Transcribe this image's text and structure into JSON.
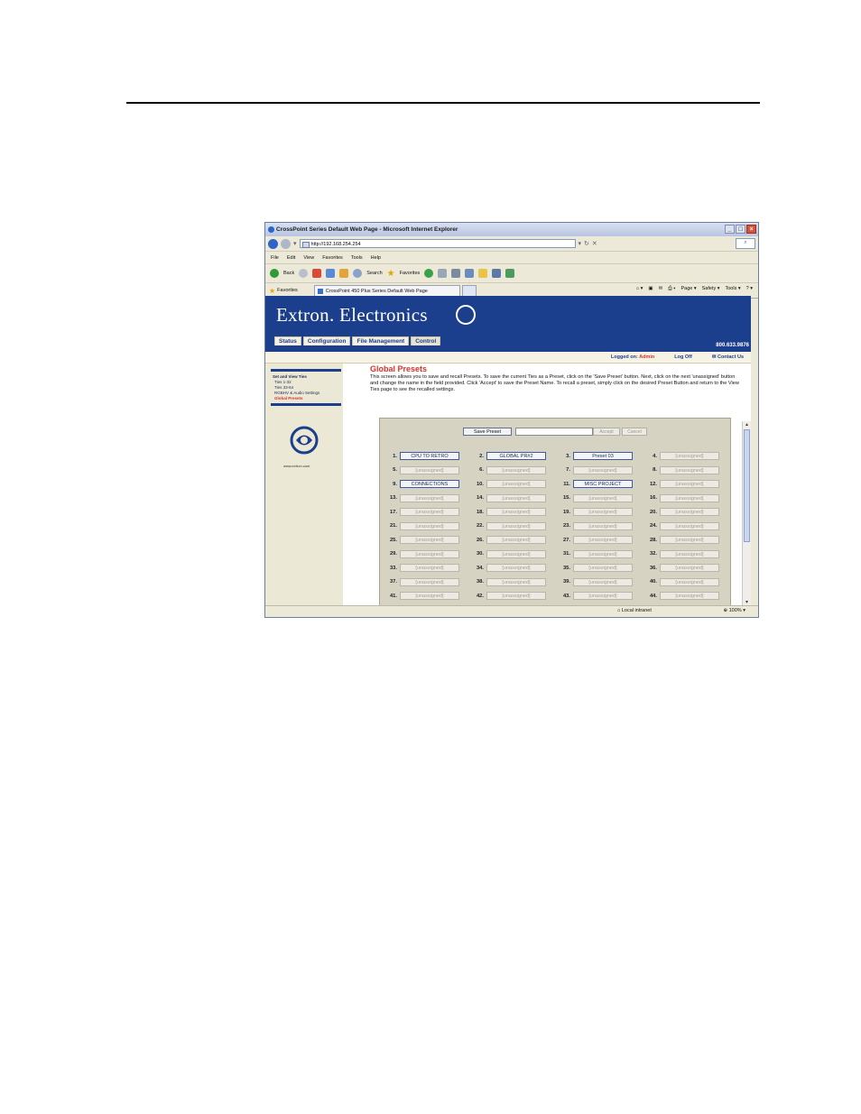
{
  "window": {
    "title": "CrossPoint Series Default Web Page - Microsoft Internet Explorer",
    "address": "http://192.168.254.254",
    "menu": [
      "File",
      "Edit",
      "View",
      "Favorites",
      "Tools",
      "Help"
    ],
    "toolbar": {
      "back": "Back",
      "search": "Search",
      "favorites": "Favorites"
    },
    "favorites_label": "Favorites",
    "tab_label": "CrossPoint 450 Plus Series Default Web Page",
    "command_bar": [
      "Page ▾",
      "Safety ▾",
      "Tools ▾",
      "? ▾"
    ],
    "status": {
      "zone": "Local intranet",
      "zoom": "100%"
    }
  },
  "site": {
    "brand": "Extron. Electronics",
    "tabs": [
      "Status",
      "Configuration",
      "File Management",
      "Control"
    ],
    "phone": "800.633.9876",
    "logged_in_label": "Logged on:",
    "user": "Admin",
    "logoff": "Log Off",
    "contact": "Contact Us"
  },
  "sidebar": {
    "heading": "Set and View Ties",
    "links": [
      "Ties 1-32",
      "Ties 33-64",
      "RGBHV & Audio Settings",
      "Global Presets"
    ],
    "url": "www.extron.com"
  },
  "main": {
    "title": "Global Presets",
    "description": "This screen allows you to save and recall Presets. To save the current Ties as a Preset, click on the 'Save Preset' button. Next, click on the next 'unassigned' button and change the name in the field provided. Click 'Accept' to save the Preset Name. To recall a preset, simply click on the desired Preset Button and return to the View Ties page to see the recalled settings.",
    "save_preset": "Save Preset",
    "accept": "Accept",
    "cancel": "Cancel",
    "presets": [
      {
        "num": "1.",
        "label": "CPU TO RETRO",
        "assigned": true
      },
      {
        "num": "2.",
        "label": "GLOBAL PR#2",
        "assigned": true
      },
      {
        "num": "3.",
        "label": "Preset 03",
        "assigned": true
      },
      {
        "num": "4.",
        "label": "[unassigned]",
        "assigned": false
      },
      {
        "num": "5.",
        "label": "[unassigned]",
        "assigned": false
      },
      {
        "num": "6.",
        "label": "[unassigned]",
        "assigned": false
      },
      {
        "num": "7.",
        "label": "[unassigned]",
        "assigned": false
      },
      {
        "num": "8.",
        "label": "[unassigned]",
        "assigned": false
      },
      {
        "num": "9.",
        "label": "CONNECTIONS",
        "assigned": true
      },
      {
        "num": "10.",
        "label": "[unassigned]",
        "assigned": false
      },
      {
        "num": "11.",
        "label": "MISC PROJECT",
        "assigned": true
      },
      {
        "num": "12.",
        "label": "[unassigned]",
        "assigned": false
      },
      {
        "num": "13.",
        "label": "[unassigned]",
        "assigned": false
      },
      {
        "num": "14.",
        "label": "[unassigned]",
        "assigned": false
      },
      {
        "num": "15.",
        "label": "[unassigned]",
        "assigned": false
      },
      {
        "num": "16.",
        "label": "[unassigned]",
        "assigned": false
      },
      {
        "num": "17.",
        "label": "[unassigned]",
        "assigned": false
      },
      {
        "num": "18.",
        "label": "[unassigned]",
        "assigned": false
      },
      {
        "num": "19.",
        "label": "[unassigned]",
        "assigned": false
      },
      {
        "num": "20.",
        "label": "[unassigned]",
        "assigned": false
      },
      {
        "num": "21.",
        "label": "[unassigned]",
        "assigned": false
      },
      {
        "num": "22.",
        "label": "[unassigned]",
        "assigned": false
      },
      {
        "num": "23.",
        "label": "[unassigned]",
        "assigned": false
      },
      {
        "num": "24.",
        "label": "[unassigned]",
        "assigned": false
      },
      {
        "num": "25.",
        "label": "[unassigned]",
        "assigned": false
      },
      {
        "num": "26.",
        "label": "[unassigned]",
        "assigned": false
      },
      {
        "num": "27.",
        "label": "[unassigned]",
        "assigned": false
      },
      {
        "num": "28.",
        "label": "[unassigned]",
        "assigned": false
      },
      {
        "num": "29.",
        "label": "[unassigned]",
        "assigned": false
      },
      {
        "num": "30.",
        "label": "[unassigned]",
        "assigned": false
      },
      {
        "num": "31.",
        "label": "[unassigned]",
        "assigned": false
      },
      {
        "num": "32.",
        "label": "[unassigned]",
        "assigned": false
      },
      {
        "num": "33.",
        "label": "[unassigned]",
        "assigned": false
      },
      {
        "num": "34.",
        "label": "[unassigned]",
        "assigned": false
      },
      {
        "num": "35.",
        "label": "[unassigned]",
        "assigned": false
      },
      {
        "num": "36.",
        "label": "[unassigned]",
        "assigned": false
      },
      {
        "num": "37.",
        "label": "[unassigned]",
        "assigned": false
      },
      {
        "num": "38.",
        "label": "[unassigned]",
        "assigned": false
      },
      {
        "num": "39.",
        "label": "[unassigned]",
        "assigned": false
      },
      {
        "num": "40.",
        "label": "[unassigned]",
        "assigned": false
      },
      {
        "num": "41.",
        "label": "[unassigned]",
        "assigned": false
      },
      {
        "num": "42.",
        "label": "[unassigned]",
        "assigned": false
      },
      {
        "num": "43.",
        "label": "[unassigned]",
        "assigned": false
      },
      {
        "num": "44.",
        "label": "[unassigned]",
        "assigned": false
      }
    ]
  },
  "colors": {
    "banner": "#1b3e8d",
    "accent": "#d8332a",
    "sidebar": "#ebe8d5",
    "panel": "#d6d3c3"
  }
}
